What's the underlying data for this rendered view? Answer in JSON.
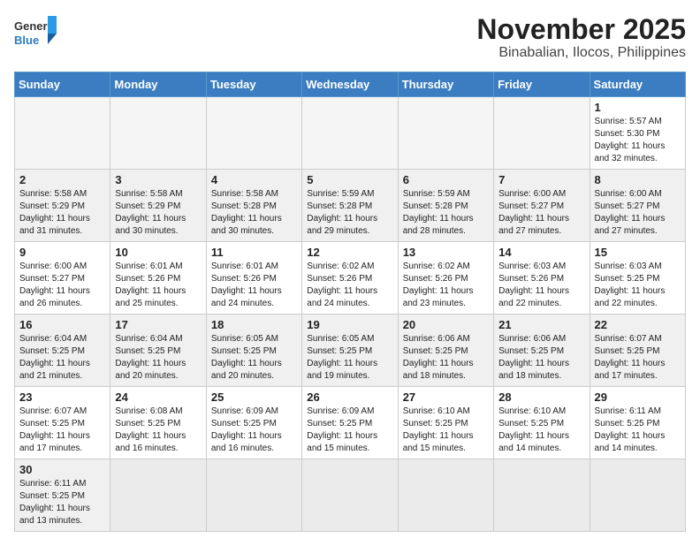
{
  "header": {
    "logo_text_black": "General",
    "logo_text_blue": "Blue",
    "month": "November 2025",
    "location": "Binabalian, Ilocos, Philippines"
  },
  "weekdays": [
    "Sunday",
    "Monday",
    "Tuesday",
    "Wednesday",
    "Thursday",
    "Friday",
    "Saturday"
  ],
  "weeks": [
    [
      {
        "day": "",
        "empty": true
      },
      {
        "day": "",
        "empty": true
      },
      {
        "day": "",
        "empty": true
      },
      {
        "day": "",
        "empty": true
      },
      {
        "day": "",
        "empty": true
      },
      {
        "day": "",
        "empty": true
      },
      {
        "day": "1",
        "sunrise": "5:57 AM",
        "sunset": "5:30 PM",
        "daylight": "11 hours and 32 minutes."
      }
    ],
    [
      {
        "day": "2",
        "sunrise": "5:58 AM",
        "sunset": "5:29 PM",
        "daylight": "11 hours and 31 minutes."
      },
      {
        "day": "3",
        "sunrise": "5:58 AM",
        "sunset": "5:29 PM",
        "daylight": "11 hours and 30 minutes."
      },
      {
        "day": "4",
        "sunrise": "5:58 AM",
        "sunset": "5:28 PM",
        "daylight": "11 hours and 30 minutes."
      },
      {
        "day": "5",
        "sunrise": "5:59 AM",
        "sunset": "5:28 PM",
        "daylight": "11 hours and 29 minutes."
      },
      {
        "day": "6",
        "sunrise": "5:59 AM",
        "sunset": "5:28 PM",
        "daylight": "11 hours and 28 minutes."
      },
      {
        "day": "7",
        "sunrise": "6:00 AM",
        "sunset": "5:27 PM",
        "daylight": "11 hours and 27 minutes."
      },
      {
        "day": "8",
        "sunrise": "6:00 AM",
        "sunset": "5:27 PM",
        "daylight": "11 hours and 27 minutes."
      }
    ],
    [
      {
        "day": "9",
        "sunrise": "6:00 AM",
        "sunset": "5:27 PM",
        "daylight": "11 hours and 26 minutes."
      },
      {
        "day": "10",
        "sunrise": "6:01 AM",
        "sunset": "5:26 PM",
        "daylight": "11 hours and 25 minutes."
      },
      {
        "day": "11",
        "sunrise": "6:01 AM",
        "sunset": "5:26 PM",
        "daylight": "11 hours and 24 minutes."
      },
      {
        "day": "12",
        "sunrise": "6:02 AM",
        "sunset": "5:26 PM",
        "daylight": "11 hours and 24 minutes."
      },
      {
        "day": "13",
        "sunrise": "6:02 AM",
        "sunset": "5:26 PM",
        "daylight": "11 hours and 23 minutes."
      },
      {
        "day": "14",
        "sunrise": "6:03 AM",
        "sunset": "5:26 PM",
        "daylight": "11 hours and 22 minutes."
      },
      {
        "day": "15",
        "sunrise": "6:03 AM",
        "sunset": "5:25 PM",
        "daylight": "11 hours and 22 minutes."
      }
    ],
    [
      {
        "day": "16",
        "sunrise": "6:04 AM",
        "sunset": "5:25 PM",
        "daylight": "11 hours and 21 minutes."
      },
      {
        "day": "17",
        "sunrise": "6:04 AM",
        "sunset": "5:25 PM",
        "daylight": "11 hours and 20 minutes."
      },
      {
        "day": "18",
        "sunrise": "6:05 AM",
        "sunset": "5:25 PM",
        "daylight": "11 hours and 20 minutes."
      },
      {
        "day": "19",
        "sunrise": "6:05 AM",
        "sunset": "5:25 PM",
        "daylight": "11 hours and 19 minutes."
      },
      {
        "day": "20",
        "sunrise": "6:06 AM",
        "sunset": "5:25 PM",
        "daylight": "11 hours and 18 minutes."
      },
      {
        "day": "21",
        "sunrise": "6:06 AM",
        "sunset": "5:25 PM",
        "daylight": "11 hours and 18 minutes."
      },
      {
        "day": "22",
        "sunrise": "6:07 AM",
        "sunset": "5:25 PM",
        "daylight": "11 hours and 17 minutes."
      }
    ],
    [
      {
        "day": "23",
        "sunrise": "6:07 AM",
        "sunset": "5:25 PM",
        "daylight": "11 hours and 17 minutes."
      },
      {
        "day": "24",
        "sunrise": "6:08 AM",
        "sunset": "5:25 PM",
        "daylight": "11 hours and 16 minutes."
      },
      {
        "day": "25",
        "sunrise": "6:09 AM",
        "sunset": "5:25 PM",
        "daylight": "11 hours and 16 minutes."
      },
      {
        "day": "26",
        "sunrise": "6:09 AM",
        "sunset": "5:25 PM",
        "daylight": "11 hours and 15 minutes."
      },
      {
        "day": "27",
        "sunrise": "6:10 AM",
        "sunset": "5:25 PM",
        "daylight": "11 hours and 15 minutes."
      },
      {
        "day": "28",
        "sunrise": "6:10 AM",
        "sunset": "5:25 PM",
        "daylight": "11 hours and 14 minutes."
      },
      {
        "day": "29",
        "sunrise": "6:11 AM",
        "sunset": "5:25 PM",
        "daylight": "11 hours and 14 minutes."
      }
    ],
    [
      {
        "day": "30",
        "sunrise": "6:11 AM",
        "sunset": "5:25 PM",
        "daylight": "11 hours and 13 minutes."
      },
      {
        "day": "",
        "empty": true
      },
      {
        "day": "",
        "empty": true
      },
      {
        "day": "",
        "empty": true
      },
      {
        "day": "",
        "empty": true
      },
      {
        "day": "",
        "empty": true
      },
      {
        "day": "",
        "empty": true
      }
    ]
  ]
}
